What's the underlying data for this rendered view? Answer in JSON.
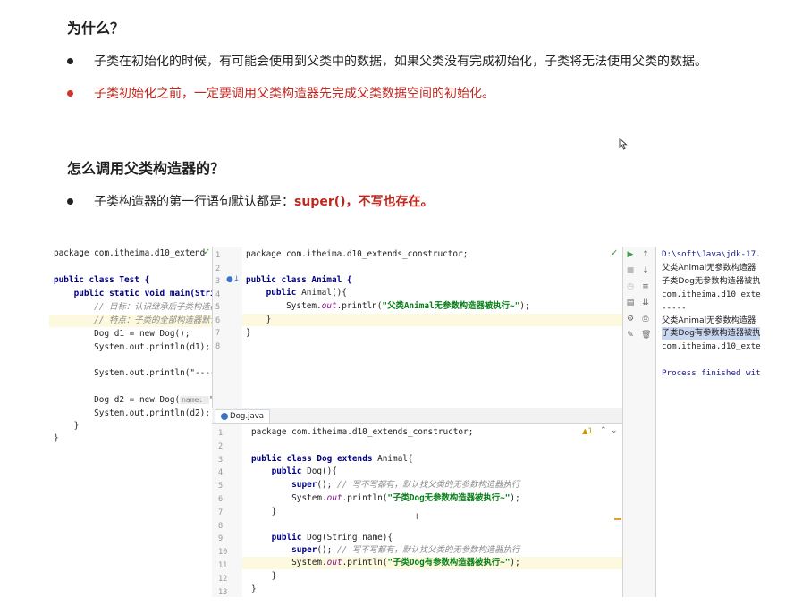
{
  "section1": {
    "title": "为什么？",
    "bullet1": "子类在初始化的时候，有可能会使用到父类中的数据，如果父类没有完成初始化，子类将无法使用父类的数据。",
    "bullet2": "子类初始化之前，一定要调用父类构造器先完成父类数据空间的初始化。"
  },
  "section2": {
    "title": "怎么调用父类构造器的？",
    "bullet1_prefix": "子类构造器的第一行语句默认都是：",
    "bullet1_highlight": "super()，不写也存在。"
  },
  "left_editor": {
    "line1": "package com.itheima.d10_extend",
    "line3": "public class Test {",
    "line4": "    public static void main(Strin",
    "line5_comment": "        // 目标：认识继承后子类构造器",
    "line6_comment": "        // 特点：子类的全部构造器默认",
    "line7": "        Dog d1 = new Dog();",
    "line8": "        System.out.println(d1);",
    "line10": "        System.out.println(\"-----",
    "line12": "        Dog d2 = new Dog(",
    "line12_hint": "name: ",
    "line12_tail": "\"",
    "line13": "        System.out.println(d2);",
    "line14": "    }",
    "line15": "}"
  },
  "animal_editor": {
    "line_numbers": [
      "1",
      "2",
      "3",
      "4",
      "5",
      "6",
      "7",
      "8"
    ],
    "line1": "package com.itheima.d10_extends_constructor;",
    "line3_kw": "public class",
    "line3_name": " Animal {",
    "line4_kw": "    public",
    "line4_name": " Animal(){",
    "line5_pre": "        System.",
    "line5_field": "out",
    "line5_mid": ".println(",
    "line5_str": "\"父类Animal无参数构造器被执行~\"",
    "line5_end": ");",
    "line6": "    }",
    "line7": "}"
  },
  "dog_editor": {
    "tab_label": "Dog.java",
    "warning": "▲1",
    "line_numbers": [
      "1",
      "2",
      "3",
      "4",
      "5",
      "6",
      "7",
      "8",
      "9",
      "10",
      "11",
      "12",
      "13"
    ],
    "line1": "package com.itheima.d10_extends_constructor;",
    "line3_kw": "public class",
    "line3_name": " Dog ",
    "line3_kw2": "extends",
    "line3_tail": " Animal{",
    "line4_kw": "    public",
    "line4_name": " Dog(){",
    "line5_kw": "        super",
    "line5_mid": "(); ",
    "line5_cm": "// 写不写都有，默认找父类的无参数构造器执行",
    "line6_pre": "        System.",
    "line6_field": "out",
    "line6_mid": ".println(",
    "line6_str": "\"子类Dog无参数构造器被执行~\"",
    "line6_end": ");",
    "line7": "    }",
    "line9_kw": "    public",
    "line9_name": " Dog(String name){",
    "line10_kw": "        super",
    "line10_mid": "(); ",
    "line10_cm": "// 写不写都有，默认找父类的无参数构造器执行",
    "line11_pre": "        System.",
    "line11_field": "out",
    "line11_mid": ".println(",
    "line11_str": "\"子类Dog有参数构造器被执行~\"",
    "line11_end": ");",
    "line12": "    }",
    "line13": "}"
  },
  "console": {
    "line1": "D:\\soft\\Java\\jdk-17.",
    "line2": "父类Animal无参数构造器",
    "line3": "子类Dog无参数构造器被执",
    "line4": "com.itheima.d10_exte",
    "line5": "-----",
    "line6": "父类Animal无参数构造器",
    "line7": "子类Dog有参数构造器被执",
    "line8": "com.itheima.d10_exte",
    "line9": "Process finished wit"
  },
  "colors": {
    "accent_red": "#c0271f",
    "run_green": "#3aa04a",
    "keyword_navy": "#000080",
    "string_green": "#067d17"
  }
}
